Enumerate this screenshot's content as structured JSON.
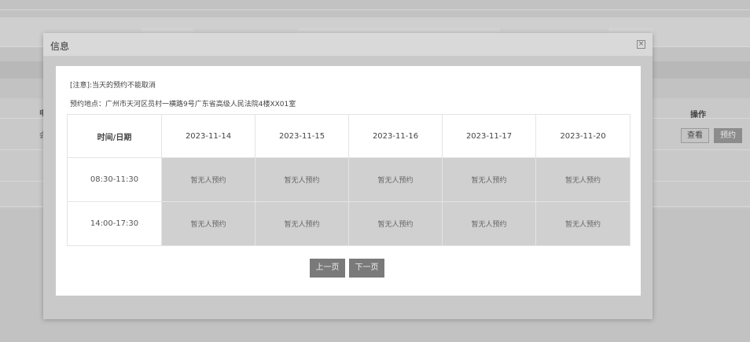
{
  "background": {
    "left_text_1": "申",
    "left_text_2": "会",
    "op_header": "操作",
    "view_label": "查看",
    "book_label": "预约"
  },
  "modal": {
    "title": "信息",
    "close_glyph": "×",
    "notice": "[注意]:当天的预约不能取消",
    "address": "预约地点：广州市天河区员村一横路9号广东省高级人民法院4楼XX01室",
    "table": {
      "corner": "时间/日期",
      "dates": [
        "2023-11-14",
        "2023-11-15",
        "2023-11-16",
        "2023-11-17",
        "2023-11-20"
      ],
      "rows": [
        {
          "time": "08:30-11:30",
          "slots": [
            "暂无人预约",
            "暂无人预约",
            "暂无人预约",
            "暂无人预约",
            "暂无人预约"
          ]
        },
        {
          "time": "14:00-17:30",
          "slots": [
            "暂无人预约",
            "暂无人预约",
            "暂无人预约",
            "暂无人预约",
            "暂无人预约"
          ]
        }
      ]
    },
    "prev_label": "上一页",
    "next_label": "下一页"
  }
}
